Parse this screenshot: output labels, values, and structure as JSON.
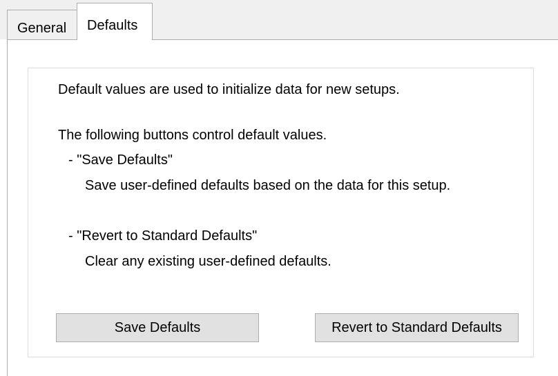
{
  "tabs": [
    {
      "label": "General",
      "active": false
    },
    {
      "label": "Defaults",
      "active": true
    }
  ],
  "defaults_page": {
    "intro": "Default values are used to initialize data for new setups.",
    "buttons_heading": "The following buttons control default values.",
    "save_item_title": "- \"Save Defaults\"",
    "save_item_description": "Save user-defined defaults based on the data for this setup.",
    "revert_item_title": "- \"Revert to Standard Defaults\"",
    "revert_item_description": "Clear any existing user-defined defaults.",
    "save_button_label": "Save Defaults",
    "revert_button_label": "Revert to Standard Defaults"
  },
  "colors": {
    "tab_strip_background": "#f0f0f0",
    "border": "#adadad",
    "button_face": "#e1e1e1"
  }
}
